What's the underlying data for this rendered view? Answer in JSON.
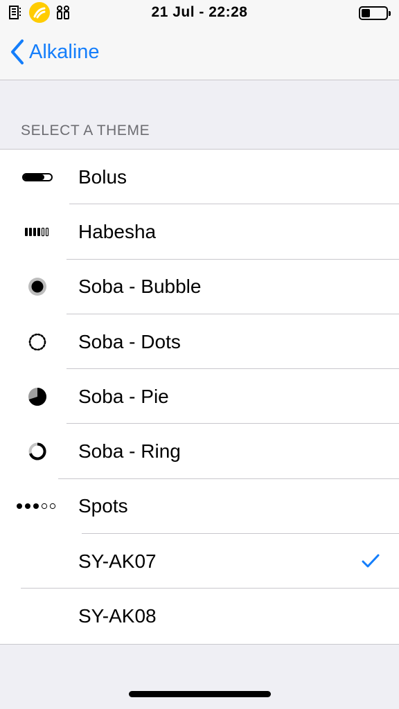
{
  "status_bar": {
    "time": "21 Jul - 22:28",
    "battery_level": 0.35
  },
  "nav": {
    "back_label": "Alkaline"
  },
  "section_header": "SELECT A THEME",
  "themes": [
    {
      "label": "Bolus",
      "icon": "bolus-icon",
      "selected": false
    },
    {
      "label": "Habesha",
      "icon": "habesha-icon",
      "selected": false
    },
    {
      "label": "Soba - Bubble",
      "icon": "soba-bubble-icon",
      "selected": false
    },
    {
      "label": "Soba - Dots",
      "icon": "soba-dots-icon",
      "selected": false
    },
    {
      "label": "Soba - Pie",
      "icon": "soba-pie-icon",
      "selected": false
    },
    {
      "label": "Soba - Ring",
      "icon": "soba-ring-icon",
      "selected": false
    },
    {
      "label": "Spots",
      "icon": "spots-icon",
      "selected": false
    },
    {
      "label": "SY-AK07",
      "icon": "",
      "selected": true
    },
    {
      "label": "SY-AK08",
      "icon": "",
      "selected": false
    }
  ],
  "colors": {
    "accent": "#147efb",
    "carrier": "#ffcc00",
    "separator": "#c8c7cc",
    "background": "#efeff4"
  }
}
